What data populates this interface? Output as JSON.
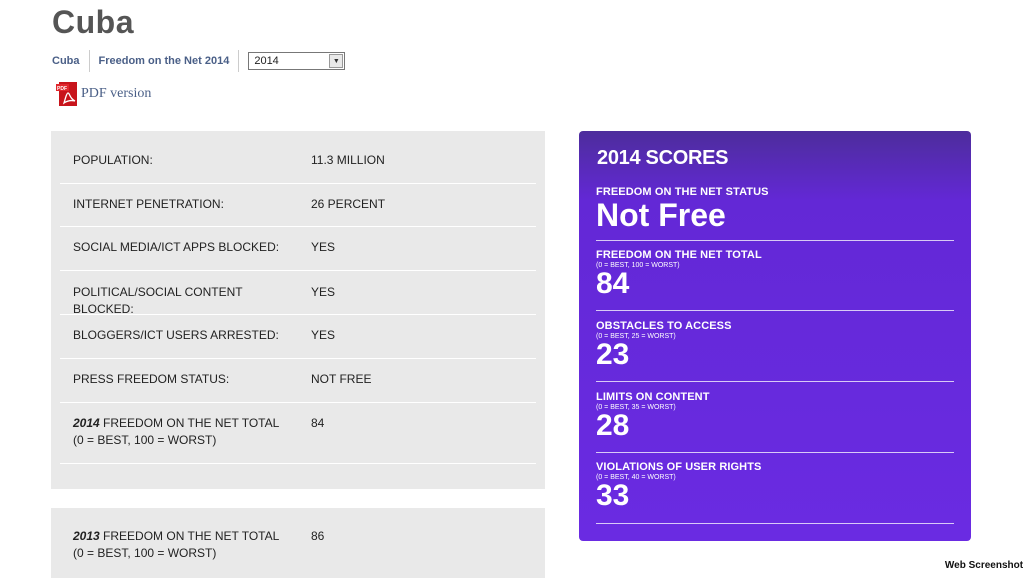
{
  "page": {
    "title": "Cuba"
  },
  "breadcrumb": {
    "country": "Cuba",
    "report": "Freedom on the Net 2014",
    "year_selected": "2014"
  },
  "pdf": {
    "label": "PDF version",
    "icon_text": "PDF"
  },
  "stats": [
    {
      "label": "POPULATION:",
      "value": "11.3 MILLION"
    },
    {
      "label": "INTERNET PENETRATION:",
      "value": "26 PERCENT"
    },
    {
      "label": "SOCIAL MEDIA/ICT APPS BLOCKED:",
      "value": "YES"
    },
    {
      "label": "POLITICAL/SOCIAL CONTENT BLOCKED:",
      "value": "YES"
    },
    {
      "label": "BLOGGERS/ICT USERS ARRESTED:",
      "value": "YES"
    },
    {
      "label": "PRESS FREEDOM STATUS:",
      "value": "NOT FREE"
    },
    {
      "year": "2014",
      "label": " FREEDOM ON THE NET TOTAL (0 = BEST, 100 = WORST)",
      "value": "84"
    }
  ],
  "stats_prev": {
    "year": "2013",
    "label": " FREEDOM ON THE NET TOTAL (0 = BEST, 100 = WORST)",
    "value": "86"
  },
  "scores": {
    "title": "2014 SCORES",
    "status_label": "FREEDOM ON THE NET STATUS",
    "status_value": "Not Free",
    "items": [
      {
        "label": "FREEDOM ON THE NET TOTAL",
        "scale": "(0 = BEST, 100 = WORST)",
        "value": "84"
      },
      {
        "label": "OBSTACLES TO ACCESS",
        "scale": "(0 = BEST, 25 = WORST)",
        "value": "23"
      },
      {
        "label": "LIMITS ON CONTENT",
        "scale": "(0 = BEST, 35 = WORST)",
        "value": "28"
      },
      {
        "label": "VIOLATIONS OF USER RIGHTS",
        "scale": "(0 = BEST, 40 = WORST)",
        "value": "33"
      }
    ]
  },
  "watermark": "Web Screenshot",
  "colors": {
    "card_purple": "#6a2be2",
    "card_top": "#4d2d9c",
    "link_blue": "#4a5f87",
    "panel_grey": "#e9e9e9",
    "pdf_red": "#c8141b"
  }
}
